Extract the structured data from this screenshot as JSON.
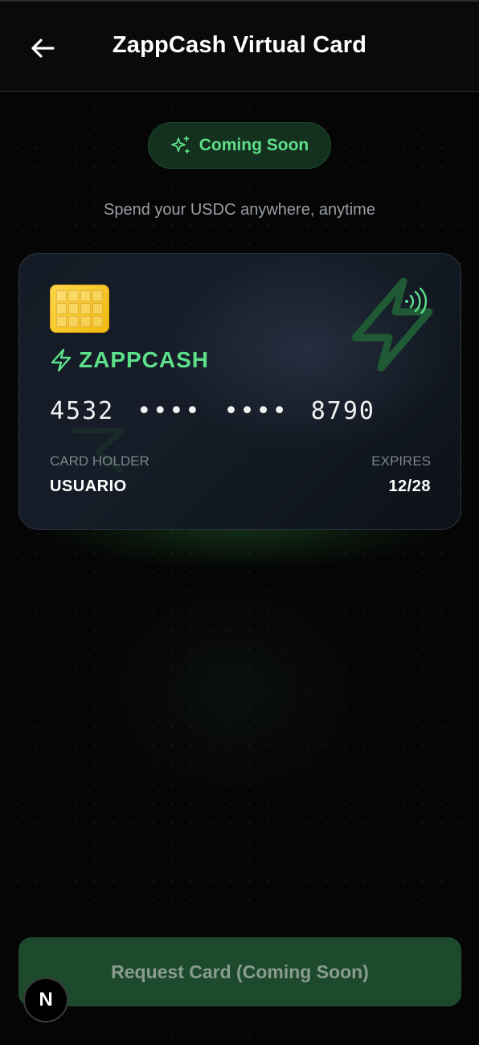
{
  "header": {
    "title": "ZappCash Virtual Card",
    "back_icon": "arrow-left-icon"
  },
  "badge": {
    "label": "Coming Soon",
    "icon": "sparkles-icon"
  },
  "subtitle": "Spend your USDC anywhere, anytime",
  "card": {
    "brand": "ZAPPCASH",
    "number_groups": [
      "4532",
      "••••",
      "••••",
      "8790"
    ],
    "holder_label": "CARD HOLDER",
    "holder_name": "USUARIO",
    "expires_label": "EXPIRES",
    "expires_value": "12/28"
  },
  "request_button": {
    "label": "Request Card (Coming Soon)"
  },
  "dev_badge": {
    "label": "N"
  },
  "colors": {
    "accent_green": "#5ee08a",
    "background": "#050505",
    "button_bg": "#1d4a2c",
    "chip_gold": "#f0b90b"
  }
}
